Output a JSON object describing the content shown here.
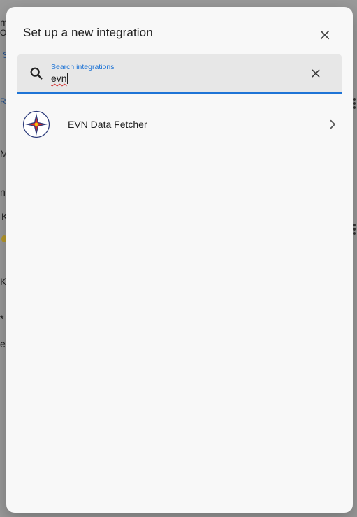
{
  "dialog": {
    "title": "Set up a new integration"
  },
  "search": {
    "label": "Search integrations",
    "value": "evn"
  },
  "results": [
    {
      "label": "EVN Data Fetcher"
    }
  ],
  "background_fragments": [
    "m",
    "ON",
    "S",
    "RE",
    "M",
    "no",
    "K",
    "Ki",
    "*",
    "er"
  ],
  "colors": {
    "accent": "#1e74d6",
    "dialog_bg": "#f8f8f8",
    "field_bg": "#e7e7e7",
    "scrim": "#9a9a9a"
  },
  "icons": {
    "close": "close-icon",
    "search": "search-icon",
    "clear": "clear-icon",
    "chevron": "chevron-right-icon",
    "integration_logo": "compass-star-icon"
  }
}
